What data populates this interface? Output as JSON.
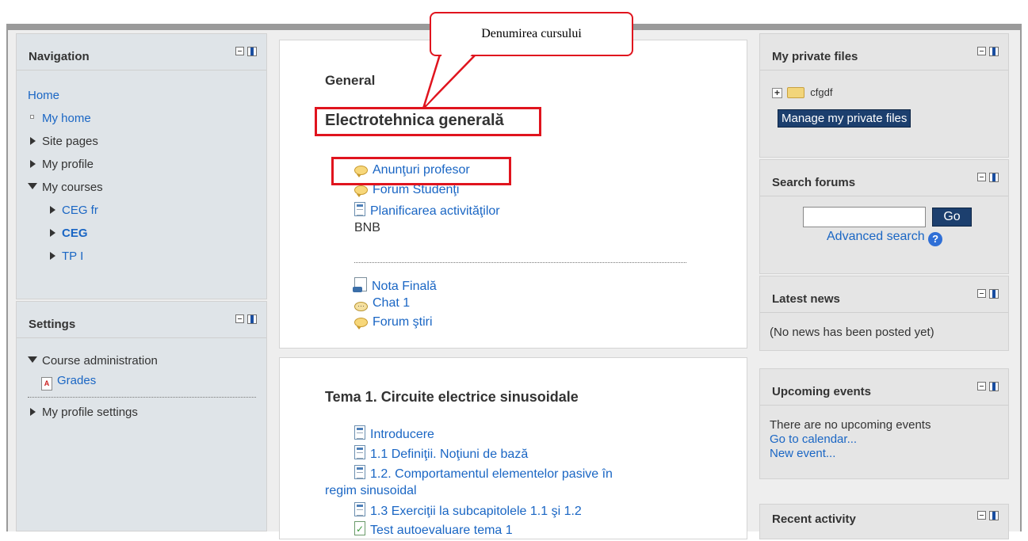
{
  "callout": {
    "text": "Denumirea cursului",
    "accent": "#e0141e"
  },
  "navigation": {
    "title": "Navigation",
    "items": [
      {
        "label": "Home",
        "type": "link",
        "level": 0
      },
      {
        "label": "My home",
        "type": "link",
        "level": 1
      },
      {
        "label": "Site pages",
        "type": "text",
        "level": 1
      },
      {
        "label": "My profile",
        "type": "text",
        "level": 1
      },
      {
        "label": "My courses",
        "type": "text",
        "level": 1
      },
      {
        "label": "CEG fr",
        "type": "link",
        "level": 2
      },
      {
        "label": "CEG",
        "type": "link",
        "level": 2
      },
      {
        "label": "TP I",
        "type": "link",
        "level": 2
      }
    ]
  },
  "settings": {
    "title": "Settings",
    "course_admin": "Course administration",
    "grades": "Grades",
    "profile_settings": "My profile settings"
  },
  "course": {
    "general_label": "General",
    "name": "Electrotehnica generală",
    "activities_top": [
      "Anunţuri profesor",
      "Forum Studenţi",
      "Planificarea activităţilor"
    ],
    "label_bnb": "BNB",
    "activities_bottom": [
      "Nota Finală",
      "Chat 1",
      "Forum ştiri"
    ],
    "topic1_title": "Tema 1. Circuite electrice sinusoidale",
    "topic1_items": [
      "Introducere",
      "1.1 Definiţii. Noţiuni de bază",
      "1.2. Comportamentul elementelor pasive în",
      "regim sinusoidal",
      "1.3 Exerciţii la subcapitolele 1.1 şi 1.2",
      "Test autoevaluare tema 1"
    ]
  },
  "private_files": {
    "title": "My private files",
    "folder": "cfgdf",
    "manage_button": "Manage my private files"
  },
  "search_forums": {
    "title": "Search forums",
    "go_button": "Go",
    "advanced": "Advanced search",
    "query": ""
  },
  "latest_news": {
    "title": "Latest news",
    "text": "(No news has been posted yet)"
  },
  "upcoming_events": {
    "title": "Upcoming events",
    "text": "There are no upcoming events",
    "calendar_link": "Go to calendar...",
    "new_event_link": "New event..."
  },
  "recent_activity": {
    "title": "Recent activity"
  }
}
